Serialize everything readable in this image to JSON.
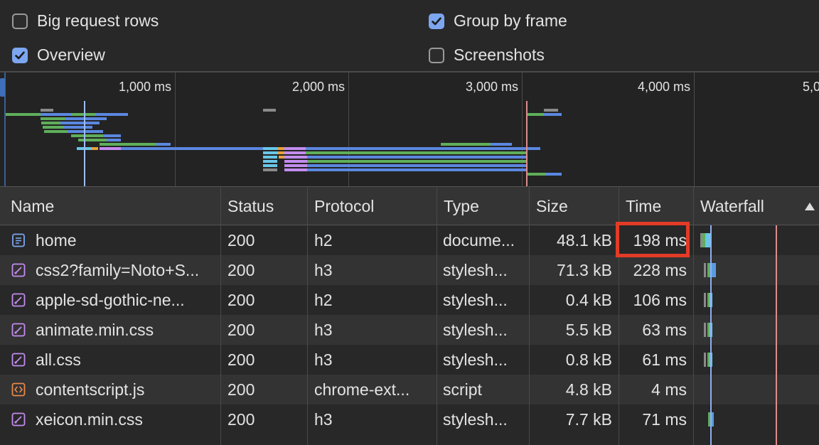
{
  "settings": {
    "big_request_rows": {
      "label": "Big request rows",
      "checked": false
    },
    "group_by_frame": {
      "label": "Group by frame",
      "checked": true
    },
    "overview": {
      "label": "Overview",
      "checked": true
    },
    "screenshots": {
      "label": "Screenshots",
      "checked": false
    }
  },
  "overview": {
    "ticks": [
      "1,000 ms",
      "2,000 ms",
      "3,000 ms",
      "4,000 ms",
      "5,0"
    ]
  },
  "table": {
    "columns": [
      "Name",
      "Status",
      "Protocol",
      "Type",
      "Size",
      "Time",
      "Waterfall"
    ],
    "sorted_column": "Waterfall",
    "rows": [
      {
        "name": "home",
        "status": "200",
        "protocol": "h2",
        "type": "docume...",
        "size": "48.1 kB",
        "time": "198 ms",
        "icon": "document-icon"
      },
      {
        "name": "css2?family=Noto+S...",
        "status": "200",
        "protocol": "h3",
        "type": "stylesh...",
        "size": "71.3 kB",
        "time": "228 ms",
        "icon": "stylesheet-icon"
      },
      {
        "name": "apple-sd-gothic-ne...",
        "status": "200",
        "protocol": "h2",
        "type": "stylesh...",
        "size": "0.4 kB",
        "time": "106 ms",
        "icon": "stylesheet-icon"
      },
      {
        "name": "animate.min.css",
        "status": "200",
        "protocol": "h3",
        "type": "stylesh...",
        "size": "5.5 kB",
        "time": "63 ms",
        "icon": "stylesheet-icon"
      },
      {
        "name": "all.css",
        "status": "200",
        "protocol": "h3",
        "type": "stylesh...",
        "size": "0.8 kB",
        "time": "61 ms",
        "icon": "stylesheet-icon"
      },
      {
        "name": "contentscript.js",
        "status": "200",
        "protocol": "chrome-ext...",
        "type": "script",
        "size": "4.8 kB",
        "time": "4 ms",
        "icon": "script-icon"
      },
      {
        "name": "xeicon.min.css",
        "status": "200",
        "protocol": "h3",
        "type": "stylesh...",
        "size": "7.7 kB",
        "time": "71 ms",
        "icon": "stylesheet-icon"
      }
    ]
  },
  "colors": {
    "checkbox_checked": "#7ca6f0",
    "highlight": "#e33b26",
    "bar_green": "#5fae5a",
    "bar_blue": "#5b87e0",
    "bar_purple": "#c38cf0",
    "bar_cyan": "#6ac6e8",
    "bar_orange": "#e6a23c",
    "bar_gray": "#8a8a8a",
    "dom_content_loaded": "#7aa2f7",
    "load_event": "#e08b8b"
  }
}
